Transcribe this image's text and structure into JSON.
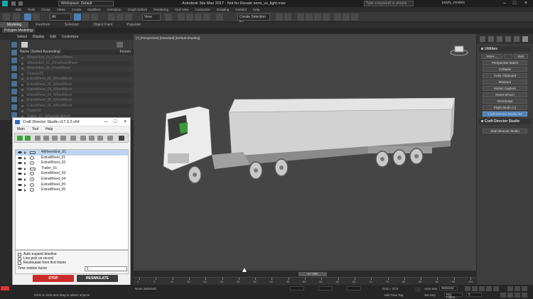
{
  "title_bar": {
    "workspace": "Workspace: Default",
    "title": "Autodesk 3ds Max 2017 - Not for Resale   semi_vs_light.max",
    "search_placeholder": "Type a keyword or phrase",
    "user": "polyfy_models",
    "minimize": "–",
    "maximize": "□",
    "close": "×"
  },
  "menu_bar": [
    "Edit",
    "Tools",
    "Group",
    "Views",
    "Create",
    "Modifiers",
    "Animation",
    "Graph Editors",
    "Rendering",
    "Civil View",
    "Customize",
    "Scripting",
    "Content",
    "Help"
  ],
  "toolbar": {
    "all_filter": "All",
    "view_ref": "View",
    "selection_set": "Create Selection Se"
  },
  "ribbon": {
    "tabs": [
      "Modeling",
      "Freeform",
      "Selection",
      "Object Paint",
      "Populate"
    ],
    "active_tab": "Modeling",
    "sub_label": "Polygon Modeling"
  },
  "scene_explorer": {
    "tabs": [
      "Select",
      "Display",
      "Edit",
      "Customize"
    ],
    "header": "Name (Sorted Ascending)",
    "frozen_label": "Frozen",
    "items": [
      "WheelsExt_01_CentreWheel",
      "WheelsExt_01_DriveAxleWheel",
      "WheelsExt_01_FrontWheel",
      "Chassis01",
      "ExtraWheel_01_WheelMesh",
      "ExtraWheel_02_WheelMesh",
      "ExtraWheel_03_WheelMesh",
      "ExtraWheel_04_WheelMesh",
      "ExtraWheel_05_WheelMesh",
      "ExtraWheel_06_WheelMesh",
      "Trailer01",
      "Trailer_01_WheelsExtMesh"
    ]
  },
  "cds": {
    "title": "Craft Director Studio v17.3.2.x64",
    "menu": [
      "Main",
      "Tool",
      "Help"
    ],
    "rows": [
      "4WheelsExt_01",
      "ExtraWheel_01",
      "ExtraWheel_02",
      "Trailer_01",
      "ExtraWheel_03",
      "ExtraWheel_04",
      "ExtraWheel_05",
      "ExtraWheel_06"
    ],
    "selected_row": "4WheelsExt_01",
    "options": [
      "Auto expand timeline",
      "Live pick on record",
      "Resimulate from first frame"
    ],
    "motion_factor_label": "Time motion factor",
    "motion_factor_value": "1",
    "stop_label": "STOP",
    "resim_label": "RESIMULATE"
  },
  "viewport": {
    "label": "[+] [Perspective] [Standard] [Default Shading]"
  },
  "command_panel": {
    "section_utilities": "Utilities",
    "more_label": "More...",
    "sets_label": "Sets",
    "utilities": [
      "Perspective Match",
      "Collapse",
      "Color Clipboard",
      "Measure",
      "Motion Capture",
      "Reset XForm",
      "MAXScript",
      "Flight Studio (c)",
      "Craft Director Studio 3M"
    ],
    "active_utility": "Craft Director Studio 3M",
    "section_cds": "Craft Director Studio",
    "start_label": "Start Director Studio"
  },
  "timeline": {
    "frame_readout": "0 / 100",
    "ticks": [
      "0",
      "5",
      "10",
      "15",
      "20",
      "25",
      "30",
      "35",
      "40",
      "45",
      "50",
      "55",
      "60",
      "65",
      "70",
      "75",
      "80",
      "85",
      "90",
      "95",
      "100"
    ]
  },
  "status_bar": {
    "prompt": "Click or click-and-drag to select objects",
    "selection_info": "None Selected",
    "grid": "Grid = 10,0",
    "add_time_tag": "Add Time Tag",
    "auto_key": "Auto Key",
    "set_key": "Set Key",
    "selected": "Selected",
    "key_filters": "Key Filters...",
    "frame": "0"
  },
  "colors": {
    "accent": "#4a7fb8",
    "stop": "#cc2b2b",
    "viewport_bg": "#454545"
  }
}
